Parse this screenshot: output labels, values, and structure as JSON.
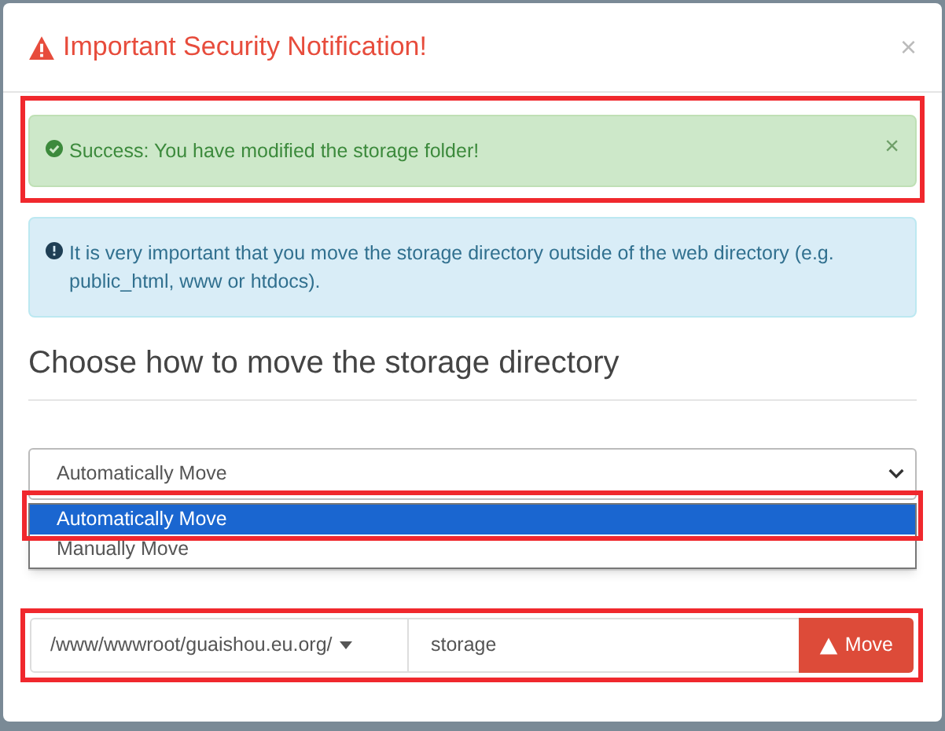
{
  "dialog": {
    "title": "Important Security Notification!",
    "close": "×"
  },
  "alerts": [
    {
      "kind": "success",
      "text": "Success: You have modified the storage folder!",
      "close": "×"
    },
    {
      "kind": "info",
      "text": "It is very important that you move the storage directory outside of the web directory (e.g. public_html, www or htdocs)."
    }
  ],
  "section_heading": "Choose how to move the storage directory",
  "select": {
    "value": "Automatically Move",
    "expanded": true,
    "options": [
      {
        "label": "Automatically Move",
        "selected": true
      },
      {
        "label": "Manually Move",
        "selected": false
      }
    ]
  },
  "path_group": {
    "prefix": "/www/wwwroot/guaishou.eu.org/",
    "value": "storage",
    "button": "Move"
  }
}
